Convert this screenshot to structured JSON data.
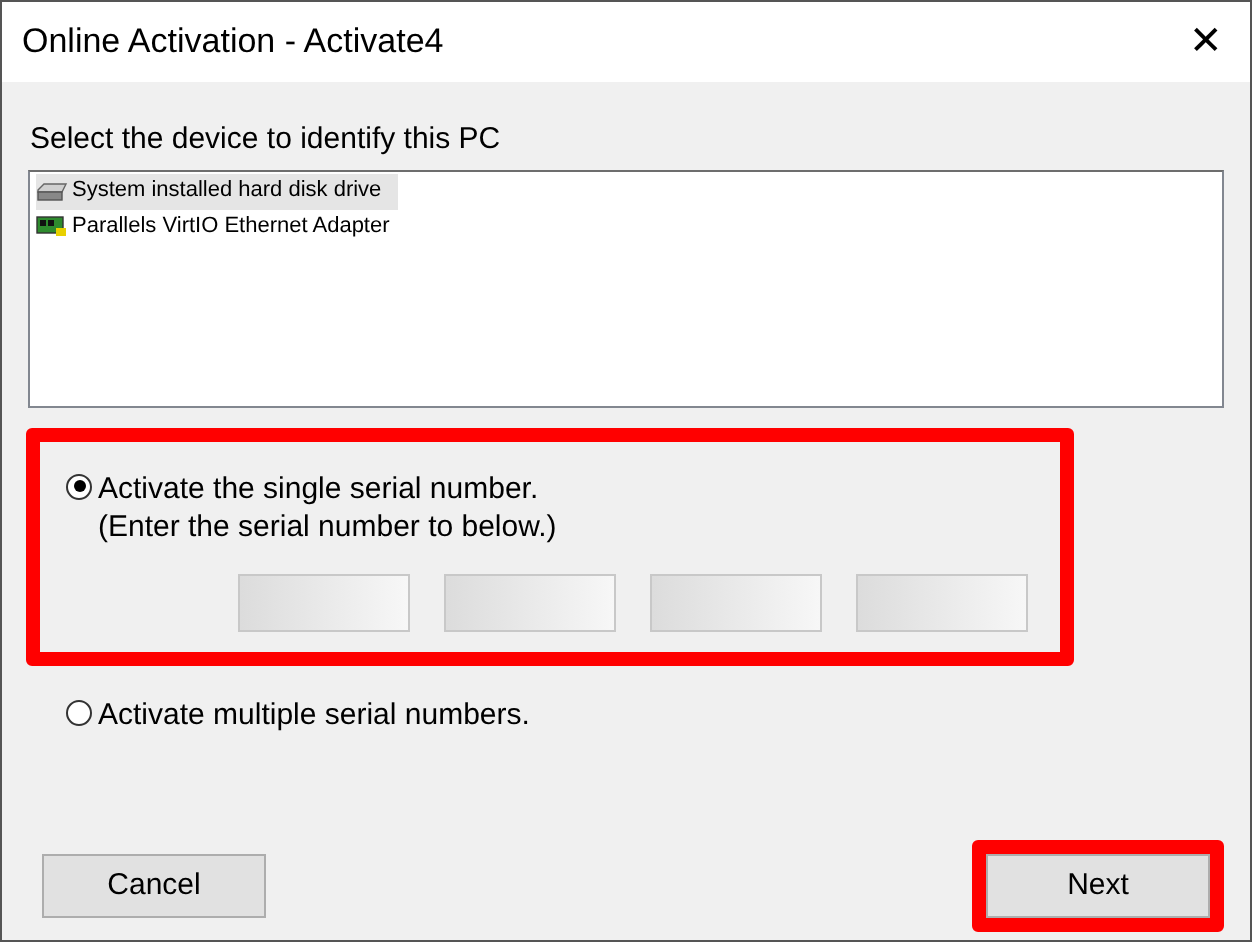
{
  "window": {
    "title": "Online Activation - Activate4",
    "close": "✕"
  },
  "device_list": {
    "label": "Select the device to identify this PC",
    "items": [
      {
        "kind": "disk",
        "label": "System installed hard disk drive",
        "selected": true
      },
      {
        "kind": "network",
        "label": "Parallels VirtIO Ethernet Adapter",
        "selected": false
      }
    ]
  },
  "options": [
    {
      "label": "Activate the single serial number.",
      "note": "(Enter the serial number to below.)",
      "selected": true,
      "highlighted": true,
      "serial_fields": [
        {
          "filled": true
        },
        {
          "filled": true
        },
        {
          "filled": true
        },
        {
          "filled": true
        }
      ]
    },
    {
      "label": "Activate multiple serial numbers.",
      "selected": false,
      "highlighted": false
    }
  ],
  "buttons": [
    {
      "label": "Cancel",
      "highlighted": false
    },
    {
      "label": "Next",
      "highlighted": true
    }
  ]
}
